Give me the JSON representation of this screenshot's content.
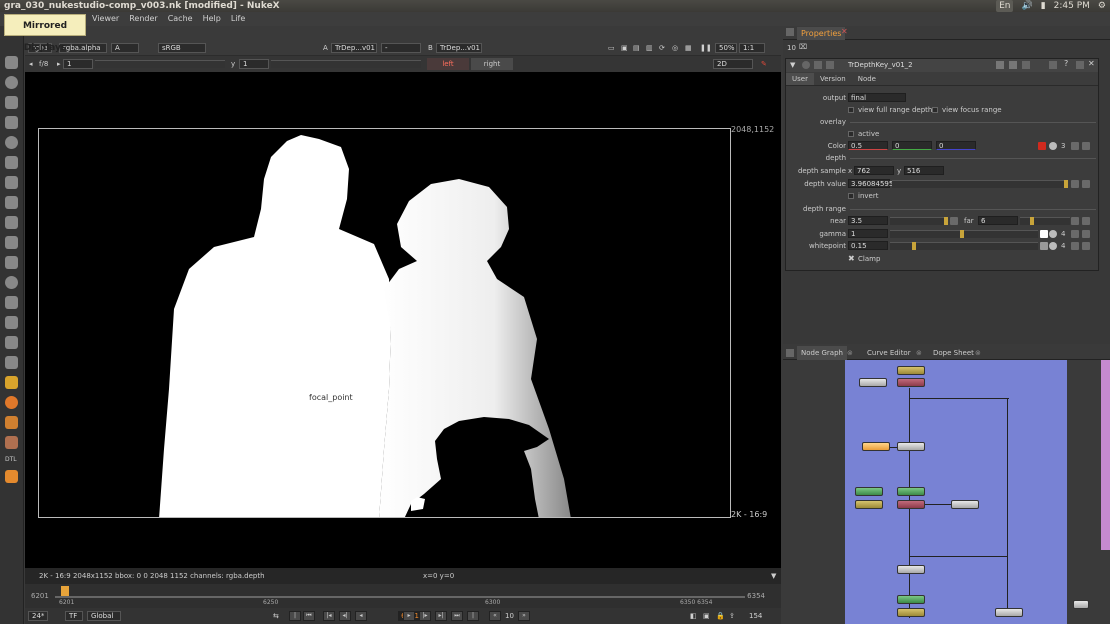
{
  "os": {
    "window_title": "gra_030_nukestudio-comp_v003.nk [modified] - NukeX",
    "lang": "En",
    "time": "2:45 PM"
  },
  "tooltip": "Mirrored Displays",
  "menu": {
    "items": [
      "Viewer",
      "Render",
      "Cache",
      "Help",
      "Life"
    ]
  },
  "viewer": {
    "channels": "rgba",
    "alpha": "rgba.alpha",
    "input_a": "A",
    "colorspace": "sRGB",
    "a_label": "A",
    "a_node": "TrDep...v01",
    "dash": "-",
    "b_label": "B",
    "b_node": "TrDep...v01",
    "zoom": "50%",
    "ratio": "1:1",
    "gain": "f/8",
    "gain_value": "1",
    "gamma_label": "y",
    "gamma_value": "1",
    "left_btn": "left",
    "right_btn": "right",
    "mode": "2D",
    "focal_label": "focal_point",
    "size_tr": "2048,1152",
    "size_br": "2K - 16:9",
    "info_text": "2K - 16:9 2048x1152  bbox: 0 0 2048 1152 channels: rgba.depth",
    "coords": "x=0 y=0"
  },
  "timeline": {
    "start": "6201",
    "end": "6354",
    "marks": [
      "6201",
      "6250",
      "6300",
      "6350 6354"
    ],
    "fps": "24*",
    "tf": "TF",
    "global": "Global",
    "current_frame": "6201",
    "step": "10",
    "end_frame": "154"
  },
  "properties": {
    "tab_label": "Properties",
    "count": "10",
    "node_name": "TrDepthKey_v01_2",
    "tabs": [
      "User",
      "Version",
      "Node"
    ],
    "output_label": "output",
    "output_value": "final",
    "view_full_range": "view full range depth",
    "view_focus_range": "view focus range",
    "overlay_label": "overlay",
    "active_label": "active",
    "color_label": "Color",
    "color_r": "0.5",
    "color_g": "0",
    "color_b": "0",
    "color_count": "3",
    "depth_label": "depth",
    "depth_sample_label": "depth sample",
    "x_label": "x",
    "x_value": "762",
    "y_label": "y",
    "y_value": "516",
    "depth_value_label": "depth value",
    "depth_value": "3.96084595",
    "invert_label": "invert",
    "depth_range_label": "depth range",
    "near_label": "near",
    "near_value": "3.5",
    "far_label": "far",
    "far_value": "6",
    "gamma_label": "gamma",
    "gamma_value": "1",
    "gamma_count": "4",
    "whitepoint_label": "whitepoint",
    "whitepoint_value": "0.15",
    "whitepoint_count": "4",
    "clamp_label": "Clamp"
  },
  "nodegraph": {
    "tabs": [
      "Node Graph",
      "Curve Editor",
      "Dope Sheet"
    ]
  },
  "colors": {
    "accent_orange": "#f2a03d",
    "left_red": "#ff6f5e",
    "node_graph_bg": "#7882d4",
    "tooltip_bg": "#f5eebc"
  }
}
